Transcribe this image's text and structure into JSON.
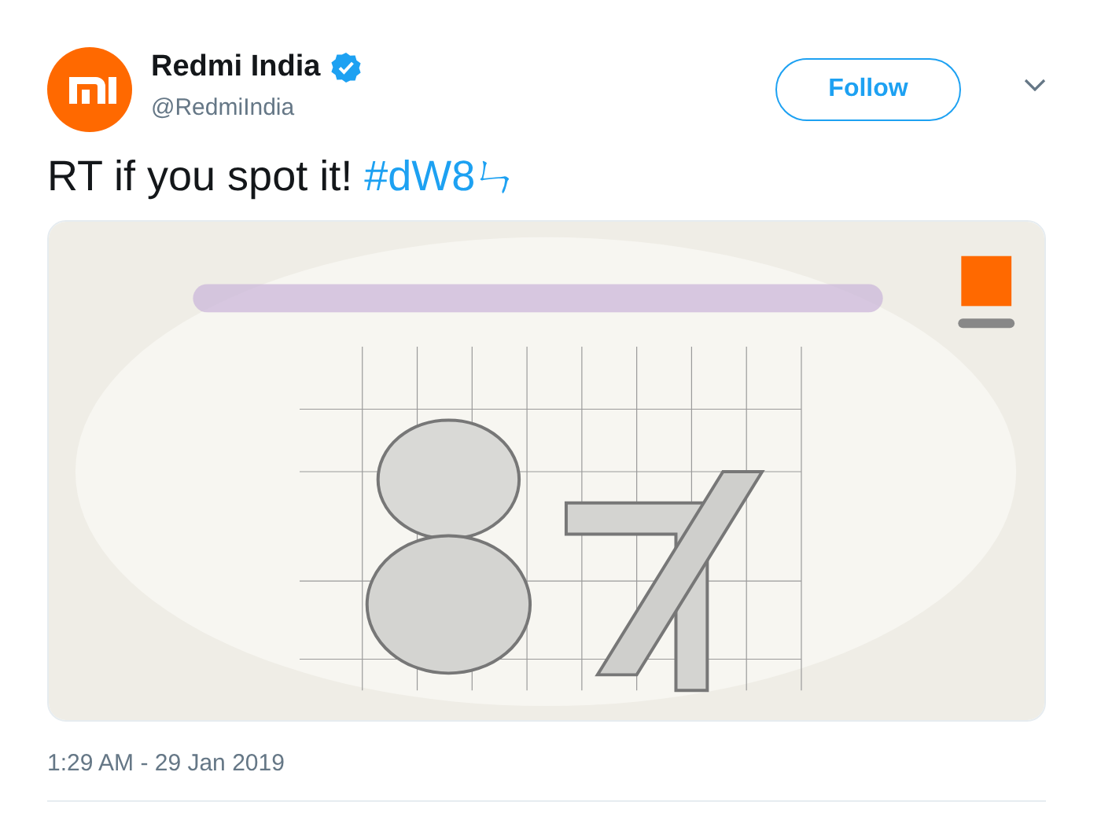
{
  "tweet": {
    "author": {
      "name": "Redmi India",
      "verified": true,
      "handle": "@RedmiIndia"
    },
    "follow_button": "Follow",
    "text": "RT if you spot it! ",
    "hashtag": "#dW8ㄣ",
    "timestamp": "1:29 AM - 29 Jan 2019"
  }
}
